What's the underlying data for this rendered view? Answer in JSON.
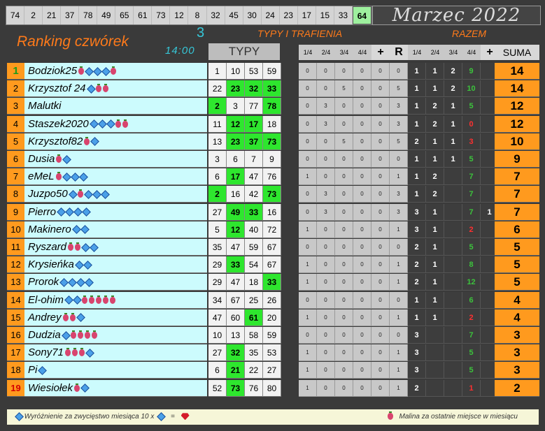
{
  "top_numbers": [
    "74",
    "2",
    "21",
    "37",
    "78",
    "49",
    "65",
    "61",
    "73",
    "12",
    "8",
    "32",
    "45",
    "30",
    "24",
    "23",
    "17",
    "15",
    "33",
    "64"
  ],
  "top_highlight": "64",
  "month": "Marzec 2022",
  "title": "Ranking czwórek",
  "round": "3",
  "time": "14:00",
  "typy_header": "TYPY I TRAFIENIA",
  "razem_header": "RAZEM",
  "typy_label": "TYPY",
  "col_small": [
    "1/4",
    "2/4",
    "3/4",
    "4/4",
    "+",
    "R"
  ],
  "col_razem": [
    "1/4",
    "2/4",
    "3/4",
    "4/4",
    "+",
    "SUMA"
  ],
  "rows": [
    {
      "rank": "1",
      "name": "Bodziok25",
      "badges": "RGGGR",
      "typy": [
        "1",
        "10",
        "53",
        "59"
      ],
      "green": [
        false,
        false,
        false,
        false
      ],
      "small": [
        "0",
        "0",
        "0",
        "0",
        "0",
        "0"
      ],
      "razem": [
        "1",
        "1",
        "2",
        "9",
        ""
      ],
      "razem_colors": [
        "w",
        "w",
        "w",
        "g",
        "w"
      ],
      "suma": "14"
    },
    {
      "rank": "2",
      "name": "Krzysztof 24",
      "badges": "GRR",
      "typy": [
        "22",
        "23",
        "32",
        "33"
      ],
      "green": [
        false,
        true,
        true,
        true
      ],
      "small": [
        "0",
        "0",
        "5",
        "0",
        "0",
        "5"
      ],
      "razem": [
        "1",
        "1",
        "2",
        "10",
        ""
      ],
      "razem_colors": [
        "w",
        "w",
        "w",
        "g",
        "w"
      ],
      "suma": "14"
    },
    {
      "rank": "3",
      "name": "Malutki",
      "badges": "",
      "typy": [
        "2",
        "3",
        "77",
        "78"
      ],
      "green": [
        true,
        false,
        false,
        true
      ],
      "small": [
        "0",
        "3",
        "0",
        "0",
        "0",
        "3"
      ],
      "razem": [
        "1",
        "2",
        "1",
        "5",
        ""
      ],
      "razem_colors": [
        "w",
        "w",
        "w",
        "g",
        "w"
      ],
      "suma": "12"
    },
    {
      "rank": "4",
      "name": "Staszek2020",
      "badges": "GGGRR",
      "typy": [
        "11",
        "12",
        "17",
        "18"
      ],
      "green": [
        false,
        true,
        true,
        false
      ],
      "small": [
        "0",
        "3",
        "0",
        "0",
        "0",
        "3"
      ],
      "razem": [
        "1",
        "2",
        "1",
        "0",
        ""
      ],
      "razem_colors": [
        "w",
        "w",
        "w",
        "r",
        "w"
      ],
      "suma": "12"
    },
    {
      "rank": "5",
      "name": "Krzysztof82",
      "badges": "RG",
      "typy": [
        "13",
        "23",
        "37",
        "73"
      ],
      "green": [
        false,
        true,
        true,
        true
      ],
      "small": [
        "0",
        "0",
        "5",
        "0",
        "0",
        "5"
      ],
      "razem": [
        "2",
        "1",
        "1",
        "3",
        ""
      ],
      "razem_colors": [
        "w",
        "w",
        "w",
        "r",
        "w"
      ],
      "suma": "10"
    },
    {
      "rank": "6",
      "name": "Dusia",
      "badges": "RG",
      "typy": [
        "3",
        "6",
        "7",
        "9"
      ],
      "green": [
        false,
        false,
        false,
        false
      ],
      "small": [
        "0",
        "0",
        "0",
        "0",
        "0",
        "0"
      ],
      "razem": [
        "1",
        "1",
        "1",
        "5",
        ""
      ],
      "razem_colors": [
        "w",
        "w",
        "w",
        "g",
        "w"
      ],
      "suma": "9"
    },
    {
      "rank": "7",
      "name": "eMeL",
      "badges": "RGGG",
      "typy": [
        "6",
        "17",
        "47",
        "76"
      ],
      "green": [
        false,
        true,
        false,
        false
      ],
      "small": [
        "1",
        "0",
        "0",
        "0",
        "0",
        "1"
      ],
      "razem": [
        "1",
        "2",
        "",
        "7",
        ""
      ],
      "razem_colors": [
        "w",
        "w",
        "w",
        "g",
        "w"
      ],
      "suma": "7"
    },
    {
      "rank": "8",
      "name": "Juzpo50",
      "badges": "GRGGG",
      "typy": [
        "2",
        "16",
        "42",
        "73"
      ],
      "green": [
        true,
        false,
        false,
        true
      ],
      "small": [
        "0",
        "3",
        "0",
        "0",
        "0",
        "3"
      ],
      "razem": [
        "1",
        "2",
        "",
        "7",
        ""
      ],
      "razem_colors": [
        "w",
        "w",
        "w",
        "g",
        "w"
      ],
      "suma": "7"
    },
    {
      "rank": "9",
      "name": "Pierro",
      "badges": "GGGG",
      "typy": [
        "27",
        "49",
        "33",
        "16"
      ],
      "green": [
        false,
        true,
        true,
        false
      ],
      "small": [
        "0",
        "3",
        "0",
        "0",
        "0",
        "3"
      ],
      "razem": [
        "3",
        "1",
        "",
        "7",
        "1"
      ],
      "razem_colors": [
        "w",
        "w",
        "w",
        "g",
        "w"
      ],
      "suma": "7"
    },
    {
      "rank": "10",
      "name": "Makinero",
      "badges": "GG",
      "typy": [
        "5",
        "12",
        "40",
        "72"
      ],
      "green": [
        false,
        true,
        false,
        false
      ],
      "small": [
        "1",
        "0",
        "0",
        "0",
        "0",
        "1"
      ],
      "razem": [
        "3",
        "1",
        "",
        "2",
        ""
      ],
      "razem_colors": [
        "w",
        "w",
        "w",
        "r",
        "w"
      ],
      "suma": "6"
    },
    {
      "rank": "11",
      "name": "Ryszard",
      "badges": "RRGG",
      "typy": [
        "35",
        "47",
        "59",
        "67"
      ],
      "green": [
        false,
        false,
        false,
        false
      ],
      "small": [
        "0",
        "0",
        "0",
        "0",
        "0",
        "0"
      ],
      "razem": [
        "2",
        "1",
        "",
        "5",
        ""
      ],
      "razem_colors": [
        "w",
        "w",
        "w",
        "g",
        "w"
      ],
      "suma": "5"
    },
    {
      "rank": "12",
      "name": "Krysieńka",
      "badges": "GG",
      "typy": [
        "29",
        "33",
        "54",
        "67"
      ],
      "green": [
        false,
        true,
        false,
        false
      ],
      "small": [
        "1",
        "0",
        "0",
        "0",
        "0",
        "1"
      ],
      "razem": [
        "2",
        "1",
        "",
        "8",
        ""
      ],
      "razem_colors": [
        "w",
        "w",
        "w",
        "g",
        "w"
      ],
      "suma": "5"
    },
    {
      "rank": "13",
      "name": "Prorok",
      "badges": "GGGG",
      "typy": [
        "29",
        "47",
        "18",
        "33"
      ],
      "green": [
        false,
        false,
        false,
        true
      ],
      "small": [
        "1",
        "0",
        "0",
        "0",
        "0",
        "1"
      ],
      "razem": [
        "2",
        "1",
        "",
        "12",
        ""
      ],
      "razem_colors": [
        "w",
        "w",
        "w",
        "g",
        "w"
      ],
      "suma": "5"
    },
    {
      "rank": "14",
      "name": "El-ohim",
      "badges": "GGRRRRR",
      "typy": [
        "34",
        "67",
        "25",
        "26"
      ],
      "green": [
        false,
        false,
        false,
        false
      ],
      "small": [
        "0",
        "0",
        "0",
        "0",
        "0",
        "0"
      ],
      "razem": [
        "1",
        "1",
        "",
        "6",
        ""
      ],
      "razem_colors": [
        "w",
        "w",
        "w",
        "g",
        "w"
      ],
      "suma": "4"
    },
    {
      "rank": "15",
      "name": "Andrey",
      "badges": "RRG",
      "typy": [
        "47",
        "60",
        "61",
        "20"
      ],
      "green": [
        false,
        false,
        true,
        false
      ],
      "small": [
        "1",
        "0",
        "0",
        "0",
        "0",
        "1"
      ],
      "razem": [
        "1",
        "1",
        "",
        "2",
        ""
      ],
      "razem_colors": [
        "w",
        "w",
        "w",
        "r",
        "w"
      ],
      "suma": "4"
    },
    {
      "rank": "16",
      "name": "Dudzia",
      "badges": "GRRRR",
      "typy": [
        "10",
        "13",
        "58",
        "59"
      ],
      "green": [
        false,
        false,
        false,
        false
      ],
      "small": [
        "0",
        "0",
        "0",
        "0",
        "0",
        "0"
      ],
      "razem": [
        "3",
        "",
        "",
        "7",
        ""
      ],
      "razem_colors": [
        "w",
        "w",
        "w",
        "g",
        "w"
      ],
      "suma": "3"
    },
    {
      "rank": "17",
      "name": "Sony71",
      "badges": "RRRG",
      "typy": [
        "27",
        "32",
        "35",
        "53"
      ],
      "green": [
        false,
        true,
        false,
        false
      ],
      "small": [
        "1",
        "0",
        "0",
        "0",
        "0",
        "1"
      ],
      "razem": [
        "3",
        "",
        "",
        "5",
        ""
      ],
      "razem_colors": [
        "w",
        "w",
        "w",
        "g",
        "w"
      ],
      "suma": "3"
    },
    {
      "rank": "18",
      "name": "Pi",
      "badges": "G",
      "typy": [
        "6",
        "21",
        "22",
        "27"
      ],
      "green": [
        false,
        true,
        false,
        false
      ],
      "small": [
        "1",
        "0",
        "0",
        "0",
        "0",
        "1"
      ],
      "razem": [
        "3",
        "",
        "",
        "5",
        ""
      ],
      "razem_colors": [
        "w",
        "w",
        "w",
        "g",
        "w"
      ],
      "suma": "3"
    },
    {
      "rank": "19",
      "name": "Wiesiołek",
      "badges": "RG",
      "typy": [
        "52",
        "73",
        "76",
        "80"
      ],
      "green": [
        false,
        true,
        false,
        false
      ],
      "small": [
        "1",
        "0",
        "0",
        "0",
        "0",
        "1"
      ],
      "razem": [
        "2",
        "",
        "",
        "1",
        ""
      ],
      "razem_colors": [
        "w",
        "w",
        "w",
        "r",
        "w"
      ],
      "suma": "2"
    }
  ],
  "footer": {
    "left_text": "Wyróżnienie za zwycięstwo miesiąca  10 x",
    "equals": "=",
    "right_text": "Malina za ostatnie miejsce w miesiącu"
  },
  "colors": {
    "rank_bg": "#ff9a1e",
    "name_bg": "#ccfbfd",
    "green_hit": "#2ee62e",
    "red_count": "#ff3030",
    "green_count": "#3cc23c"
  },
  "icons": {
    "gem": "blue-diamond-icon",
    "raspberry": "raspberry-icon",
    "ruby": "ruby-icon"
  }
}
